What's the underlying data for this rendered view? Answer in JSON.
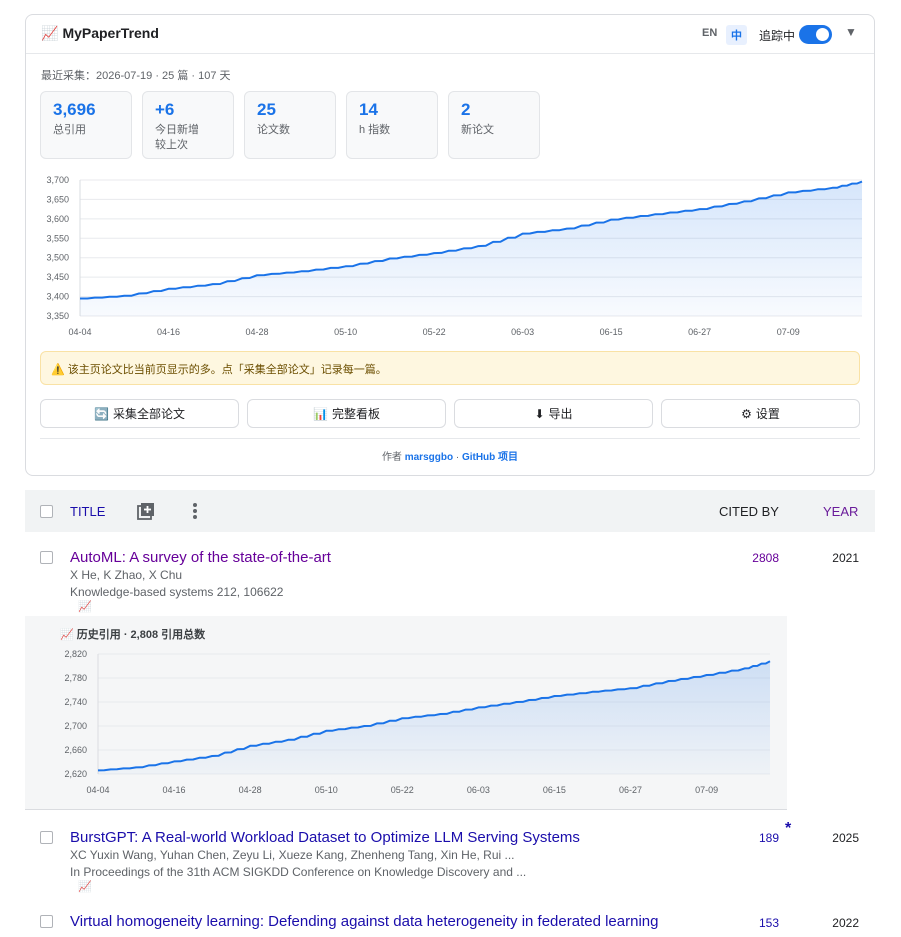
{
  "header": {
    "brand_icon": "📈",
    "brand": "MyPaperTrend",
    "lang_en": "EN",
    "lang_zh": "中",
    "tracking_label": "追踪中",
    "collapse_icon": "▼"
  },
  "summary": {
    "last_collect": "最近采集：2026-07-19 · 25 篇 · 107 天",
    "stats": [
      {
        "value": "3,696",
        "label": "总引用"
      },
      {
        "value": "+6",
        "label": "今日新增",
        "sub": "较上次"
      },
      {
        "value": "25",
        "label": "论文数"
      },
      {
        "value": "14",
        "label": "h 指数"
      },
      {
        "value": "2",
        "label": "新论文"
      }
    ]
  },
  "chart_data": [
    {
      "type": "area",
      "series": [
        {
          "x": [
            "2026-04-04",
            "2026-04-10",
            "2026-04-16",
            "2026-04-22",
            "2026-04-28",
            "2026-05-04",
            "2026-05-10",
            "2026-05-16",
            "2026-05-22",
            "2026-05-28",
            "2026-06-03",
            "2026-06-09",
            "2026-06-15",
            "2026-06-21",
            "2026-06-27",
            "2026-07-03",
            "2026-07-09",
            "2026-07-15",
            "2026-07-19"
          ],
          "values": [
            3395,
            3402,
            3420,
            3432,
            3455,
            3465,
            3478,
            3498,
            3512,
            3530,
            3562,
            3575,
            3598,
            3612,
            3625,
            3645,
            3668,
            3680,
            3696
          ]
        }
      ],
      "x_tick_labels": [
        "04-04",
        "04-16",
        "04-28",
        "05-10",
        "05-22",
        "06-03",
        "06-15",
        "06-27",
        "07-09"
      ],
      "y_tick_labels": [
        "3,350",
        "3,400",
        "3,450",
        "3,500",
        "3,550",
        "3,600",
        "3,650",
        "3,700"
      ],
      "ylim": [
        3350,
        3700
      ],
      "grid": true
    },
    {
      "type": "area",
      "title": "历史引用 · 2,808 引用总数",
      "series": [
        {
          "x": [
            "2026-04-04",
            "2026-04-10",
            "2026-04-16",
            "2026-04-22",
            "2026-04-28",
            "2026-05-04",
            "2026-05-10",
            "2026-05-16",
            "2026-05-22",
            "2026-05-28",
            "2026-06-03",
            "2026-06-09",
            "2026-06-15",
            "2026-06-21",
            "2026-06-27",
            "2026-07-03",
            "2026-07-09",
            "2026-07-15",
            "2026-07-19"
          ],
          "values": [
            2626,
            2631,
            2641,
            2650,
            2667,
            2677,
            2692,
            2700,
            2713,
            2720,
            2731,
            2740,
            2750,
            2757,
            2763,
            2775,
            2785,
            2796,
            2808
          ]
        }
      ],
      "x_tick_labels": [
        "04-04",
        "04-16",
        "04-28",
        "05-10",
        "05-22",
        "06-03",
        "06-15",
        "06-27",
        "07-09"
      ],
      "y_tick_labels": [
        "2,620",
        "2,660",
        "2,700",
        "2,740",
        "2,780",
        "2,820"
      ],
      "ylim": [
        2620,
        2820
      ],
      "grid": true
    }
  ],
  "warning": {
    "icon": "⚠️",
    "text": "该主页论文比当前页显示的多。点「采集全部论文」记录每一篇。"
  },
  "actions": [
    {
      "icon": "🔄",
      "label": "采集全部论文"
    },
    {
      "icon": "📊",
      "label": "完整看板"
    },
    {
      "icon": "⬇",
      "label": "导出"
    },
    {
      "icon": "⚙",
      "label": "设置"
    }
  ],
  "credits": {
    "prefix": "作者",
    "author": "marsggbo",
    "sep": " · ",
    "project": "GitHub 项目"
  },
  "table": {
    "col_title": "TITLE",
    "col_cited": "CITED BY",
    "col_year": "YEAR",
    "rows": [
      {
        "title": "AutoML: A survey of the state-of-the-art",
        "authors": "X He, K Zhao, X Chu",
        "venue": "Knowledge-based systems 212, 106622",
        "cited": "2808",
        "year": "2021",
        "trend_icon": "📈"
      },
      {
        "title": "BurstGPT: A Real-world Workload Dataset to Optimize LLM Serving Systems",
        "authors": "XC Yuxin Wang, Yuhan Chen, Zeyu Li, Xueze Kang, Zhenheng Tang, Xin He, Rui ...",
        "venue": "In Proceedings of the 31th ACM SIGKDD Conference on Knowledge Discovery and ...",
        "cited": "189",
        "star": "*",
        "year": "2025",
        "trend_icon": "📈"
      },
      {
        "title": "Virtual homogeneity learning: Defending against data heterogeneity in federated learning",
        "cited": "153",
        "year": "2022"
      }
    ]
  },
  "expand": {
    "icon": "📈"
  }
}
